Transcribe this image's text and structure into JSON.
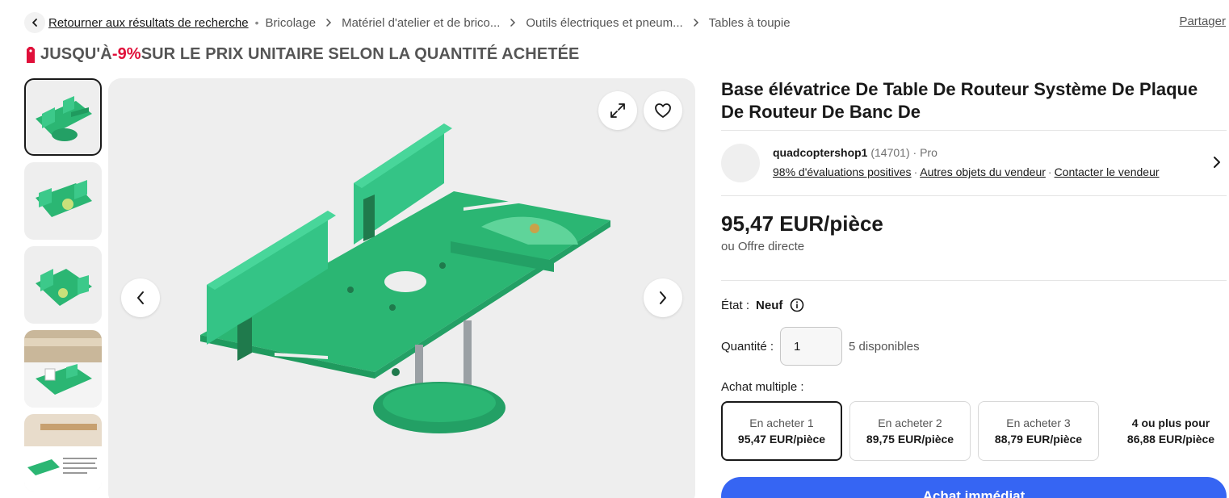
{
  "breadcrumb": {
    "back": "Retourner aux résultats de recherche",
    "items": [
      "Bricolage",
      "Matériel d'atelier et de brico...",
      "Outils électriques et pneum...",
      "Tables à toupie"
    ]
  },
  "share": "Partager",
  "promo": {
    "prefix": "JUSQU'À ",
    "percent": "-9%",
    "suffix": " SUR LE PRIX UNITAIRE SELON LA QUANTITÉ ACHETÉE",
    "accent_color": "#e0103a"
  },
  "gallery": {
    "thumbnail_count": 5,
    "active_index": 0
  },
  "product": {
    "title": "Base élévatrice De Table De Routeur Système De Plaque De Routeur De Banc De"
  },
  "seller": {
    "name": "quadcoptershop1",
    "feedback_count": "(14701)",
    "type": "· Pro",
    "positive": "98% d'évaluations positives",
    "other_items": "Autres objets du vendeur",
    "contact": "Contacter le vendeur"
  },
  "price": {
    "main": "95,47 EUR/pièce",
    "offer": "ou Offre directe"
  },
  "condition": {
    "label": "État :",
    "value": "Neuf"
  },
  "quantity": {
    "label": "Quantité :",
    "value": "1",
    "available": "5 disponibles"
  },
  "multi_buy": {
    "label": "Achat multiple :",
    "tiers": [
      {
        "label": "En acheter 1",
        "price": "95,47 EUR/pièce"
      },
      {
        "label": "En acheter 2",
        "price": "89,75 EUR/pièce"
      },
      {
        "label": "En acheter 3",
        "price": "88,79 EUR/pièce"
      },
      {
        "label": "4 ou plus pour",
        "price": "86,88 EUR/pièce"
      }
    ]
  },
  "buy_now": "Achat immédiat",
  "colors": {
    "primary_blue": "#3665f3",
    "product_green": "#2bb673"
  }
}
